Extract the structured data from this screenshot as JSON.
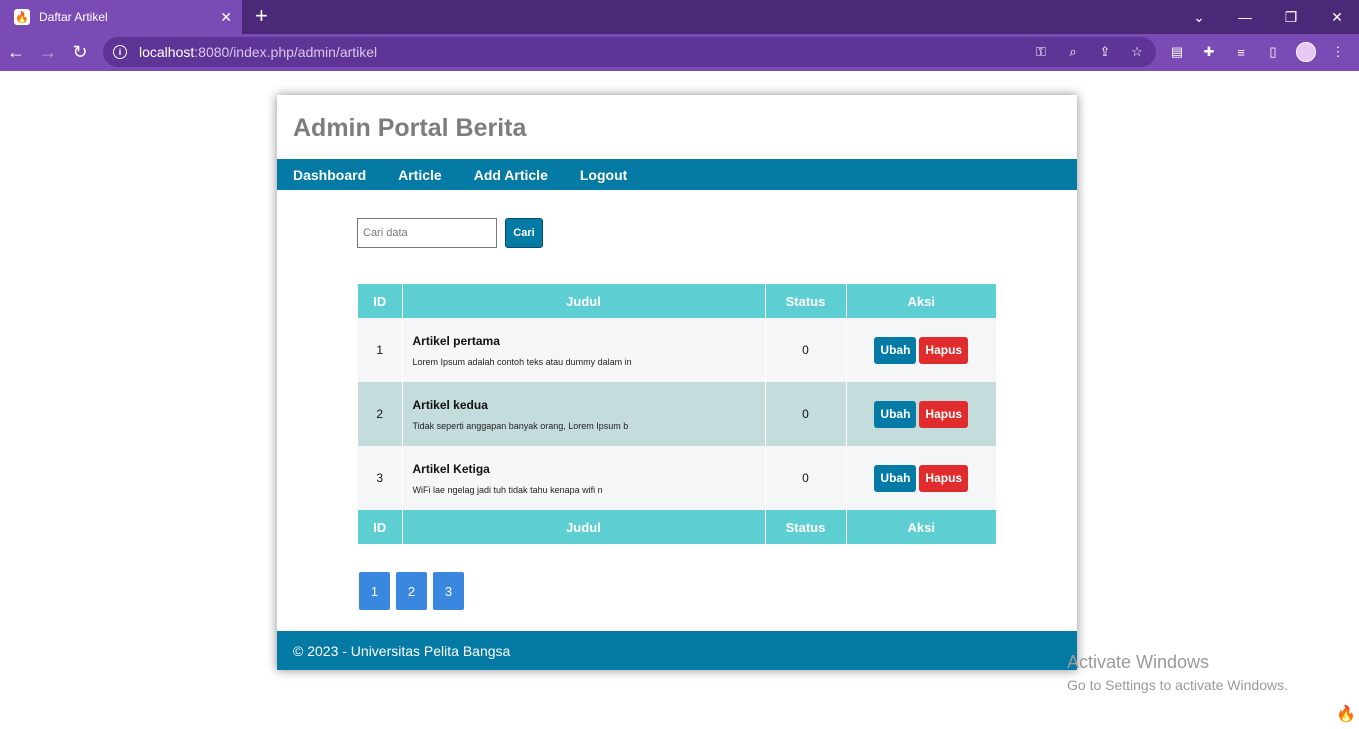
{
  "browser": {
    "tab_title": "Daftar Artikel",
    "tab_favicon": "flame-icon",
    "url_host": "localhost",
    "url_rest": ":8080/index.php/admin/artikel"
  },
  "site": {
    "title": "Admin Portal Berita",
    "nav": [
      "Dashboard",
      "Article",
      "Add Article",
      "Logout"
    ]
  },
  "search": {
    "placeholder": "Cari data",
    "button_label": "Cari"
  },
  "table": {
    "headers": [
      "ID",
      "Judul",
      "Status",
      "Aksi"
    ],
    "rows": [
      {
        "id": "1",
        "title": "Artikel pertama",
        "excerpt": "Lorem Ipsum adalah contoh teks atau dummy dalam in",
        "status": "0",
        "edit": "Ubah",
        "delete": "Hapus"
      },
      {
        "id": "2",
        "title": "Artikel kedua",
        "excerpt": "Tidak seperti anggapan banyak orang, Lorem Ipsum b",
        "status": "0",
        "edit": "Ubah",
        "delete": "Hapus"
      },
      {
        "id": "3",
        "title": "Artikel Ketiga",
        "excerpt": "WiFi lae ngelag jadi tuh tidak tahu kenapa wifi n",
        "status": "0",
        "edit": "Ubah",
        "delete": "Hapus"
      }
    ]
  },
  "pagination": [
    "1",
    "2",
    "3"
  ],
  "footer": "© 2023 - Universitas Pelita Bangsa",
  "watermark": {
    "title": "Activate Windows",
    "subtitle": "Go to Settings to activate Windows."
  },
  "colors": {
    "brand": "#047aa4",
    "table_header": "#5dcfd3",
    "delete": "#e02c2c",
    "pagination": "#3a87e0"
  }
}
